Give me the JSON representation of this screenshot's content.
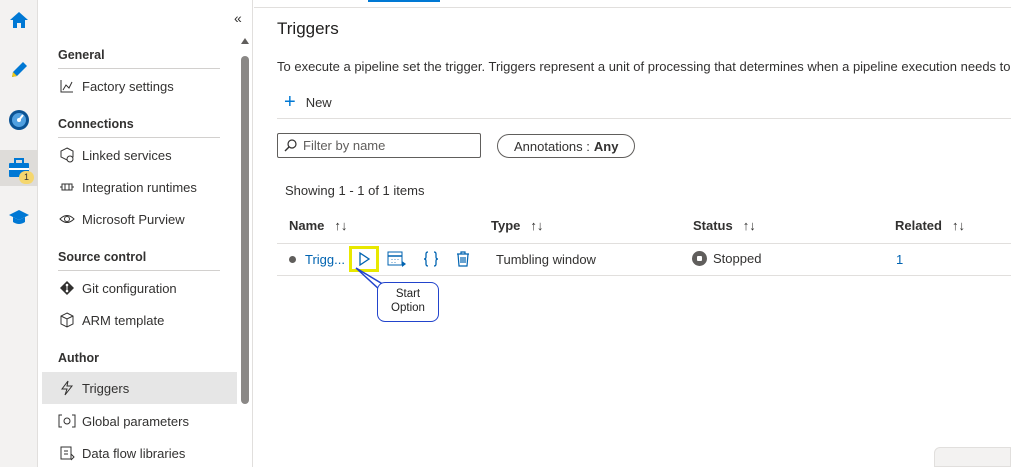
{
  "rail": {
    "icons": [
      "home-icon",
      "pencil-icon",
      "monitor-icon",
      "toolbox-icon",
      "learn-icon"
    ],
    "manage_badge": "1"
  },
  "nav": {
    "sections": {
      "general": "General",
      "connections": "Connections",
      "source_control": "Source control",
      "author": "Author"
    },
    "items": {
      "factory_settings": "Factory settings",
      "linked_services": "Linked services",
      "integration_runtimes": "Integration runtimes",
      "purview": "Microsoft Purview",
      "git_configuration": "Git configuration",
      "arm_template": "ARM template",
      "triggers": "Triggers",
      "global_parameters": "Global parameters",
      "data_flow_libraries": "Data flow libraries"
    }
  },
  "main": {
    "title": "Triggers",
    "description": "To execute a pipeline set the trigger. Triggers represent a unit of processing that determines when a pipeline execution needs to",
    "new_label": "New",
    "filter_placeholder": "Filter by name",
    "annotations_label": "Annotations :",
    "annotations_value": "Any",
    "showing": "Showing 1 - 1 of 1 items",
    "columns": {
      "name": "Name",
      "type": "Type",
      "status": "Status",
      "related": "Related"
    },
    "rows": [
      {
        "name": "Trigg...",
        "type": "Tumbling window",
        "status": "Stopped",
        "related": "1"
      }
    ],
    "callout": {
      "line1": "Start",
      "line2": "Option"
    }
  }
}
